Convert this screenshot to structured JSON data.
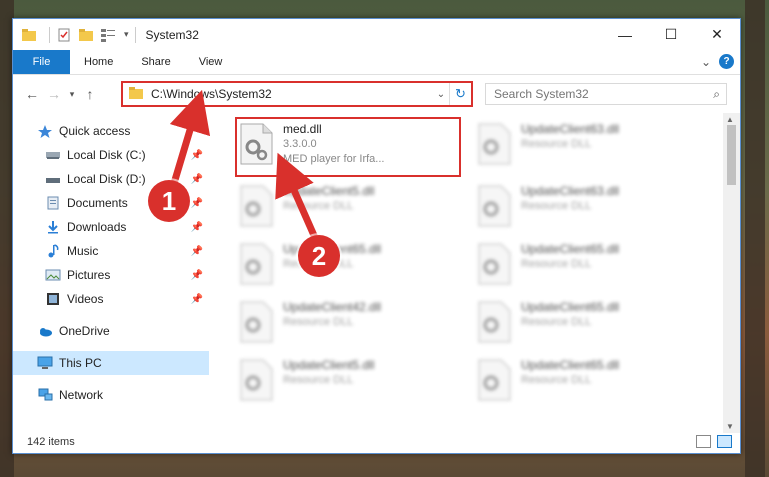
{
  "window": {
    "title": "System32",
    "controls": {
      "minimize": "—",
      "maximize": "☐",
      "close": "✕"
    }
  },
  "ribbon": {
    "tabs": [
      "File",
      "Home",
      "Share",
      "View"
    ],
    "expand_glyph": "⌄",
    "help_glyph": "?"
  },
  "address": {
    "path": "C:\\Windows\\System32",
    "search_placeholder": "Search System32"
  },
  "sidebar": {
    "items": [
      {
        "label": "Quick access",
        "icon": "star-icon"
      },
      {
        "label": "Local Disk (C:)",
        "icon": "drive-icon",
        "pinned": true
      },
      {
        "label": "Local Disk (D:)",
        "icon": "drive-icon",
        "pinned": true
      },
      {
        "label": "Documents",
        "icon": "documents-icon",
        "pinned": true
      },
      {
        "label": "Downloads",
        "icon": "download-icon",
        "pinned": true
      },
      {
        "label": "Music",
        "icon": "music-icon",
        "pinned": true
      },
      {
        "label": "Pictures",
        "icon": "pictures-icon",
        "pinned": true
      },
      {
        "label": "Videos",
        "icon": "videos-icon",
        "pinned": true
      },
      {
        "label": "OneDrive",
        "icon": "cloud-icon"
      },
      {
        "label": "This PC",
        "icon": "computer-icon",
        "selected": true
      },
      {
        "label": "Network",
        "icon": "network-icon"
      }
    ]
  },
  "files": {
    "highlighted": {
      "name": "med.dll",
      "version": "3.3.0.0",
      "description": "MED player for Irfa..."
    },
    "col1": [
      {
        "name": "UpdateClient5.dll",
        "type": "Resource DLL"
      },
      {
        "name": "UpdateClient65.dll",
        "type": "Resource DLL"
      },
      {
        "name": "UpdateClient42.dll",
        "type": "Resource DLL"
      },
      {
        "name": "UpdateClient5.dll",
        "type": "Resource DLL"
      }
    ],
    "col2": [
      {
        "name": "UpdateClient63.dll",
        "type": "Resource DLL"
      },
      {
        "name": "UpdateClient63.dll",
        "type": "Resource DLL"
      },
      {
        "name": "UpdateClient65.dll",
        "type": "Resource DLL"
      },
      {
        "name": "UpdateClient65.dll",
        "type": "Resource DLL"
      },
      {
        "name": "UpdateClient65.dll",
        "type": "Resource DLL"
      }
    ]
  },
  "status": {
    "item_count": "142 items"
  },
  "annotations": {
    "step1": "1",
    "step2": "2"
  },
  "colors": {
    "accent": "#1979ca",
    "highlight": "#d9302c",
    "selected": "#cce8ff"
  }
}
